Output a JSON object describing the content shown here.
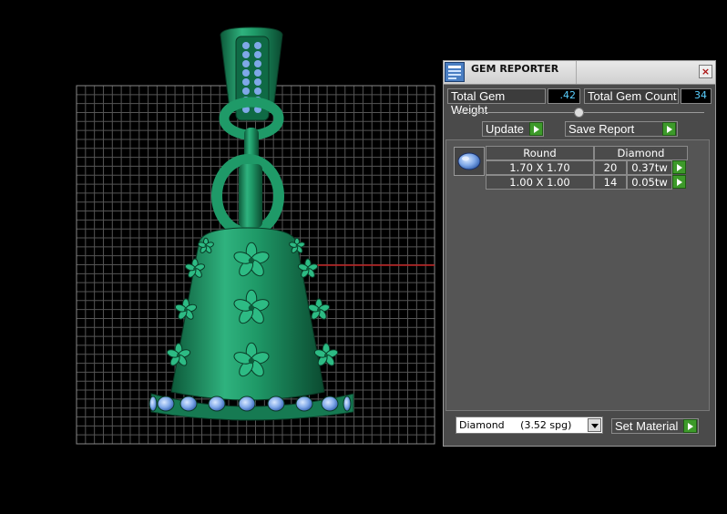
{
  "panel": {
    "title": "GEM REPORTER",
    "close_icon": "×",
    "total_weight_label": "Total Gem Weight",
    "total_weight_value": ".42",
    "total_count_label": "Total Gem Count",
    "total_count_value": "34",
    "update_label": "Update",
    "save_report_label": "Save Report",
    "table": {
      "header_shape": "Round",
      "header_material": "Diamond",
      "rows": [
        {
          "size": "1.70 X 1.70",
          "count": "20",
          "weight": "0.37tw"
        },
        {
          "size": "1.00 X 1.00",
          "count": "14",
          "weight": "0.05tw"
        }
      ]
    },
    "material_select": "Diamond     (3.52 spg)",
    "set_material_label": "Set Material"
  },
  "colors": {
    "model_green": "#1f8a5e",
    "gem_blue": "#7fa8e8",
    "accent_cyan": "#5ad0ff",
    "button_green": "#3d9a2a"
  }
}
